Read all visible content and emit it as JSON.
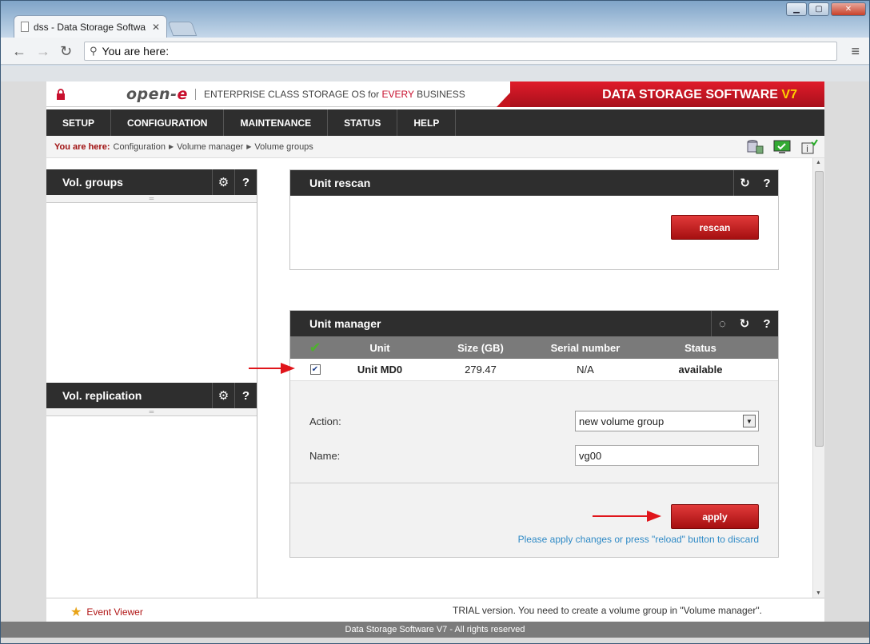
{
  "browser": {
    "tab_title": "dss - Data Storage Softwa",
    "address_text": "You are here:"
  },
  "header": {
    "logo_left": "open-",
    "logo_e": "e",
    "tagline_a": "ENTERPRISE CLASS STORAGE OS for ",
    "tagline_every": "EVERY",
    "tagline_b": " BUSINESS",
    "brand": "DATA STORAGE SOFTWARE ",
    "brand_version": "V7"
  },
  "menu": [
    "SETUP",
    "CONFIGURATION",
    "MAINTENANCE",
    "STATUS",
    "HELP"
  ],
  "breadcrumb": {
    "lead": "You are here:",
    "items": [
      "Configuration",
      "Volume manager",
      "Volume groups"
    ]
  },
  "left": {
    "vol_groups": "Vol. groups",
    "vol_replication": "Vol. replication"
  },
  "unit_rescan": {
    "title": "Unit rescan",
    "button": "rescan"
  },
  "unit_manager": {
    "title": "Unit manager",
    "columns": [
      "Unit",
      "Size (GB)",
      "Serial number",
      "Status"
    ],
    "rows": [
      {
        "unit": "Unit MD0",
        "size": "279.47",
        "serial": "N/A",
        "status": "available",
        "checked": true
      }
    ],
    "action_label": "Action:",
    "action_value": "new volume group",
    "name_label": "Name:",
    "name_value": "vg00",
    "apply_button": "apply",
    "hint": "Please apply changes or press \"reload\" button to discard"
  },
  "statusbar": {
    "event_viewer": "Event Viewer",
    "message": "TRIAL version. You need to create a volume group in \"Volume manager\"."
  },
  "footer": "Data Storage Software V7 - All rights reserved",
  "colors": {
    "accent_red": "#c8102e",
    "header_dark": "#2e2e2e",
    "link_blue": "#2f8ac6"
  }
}
